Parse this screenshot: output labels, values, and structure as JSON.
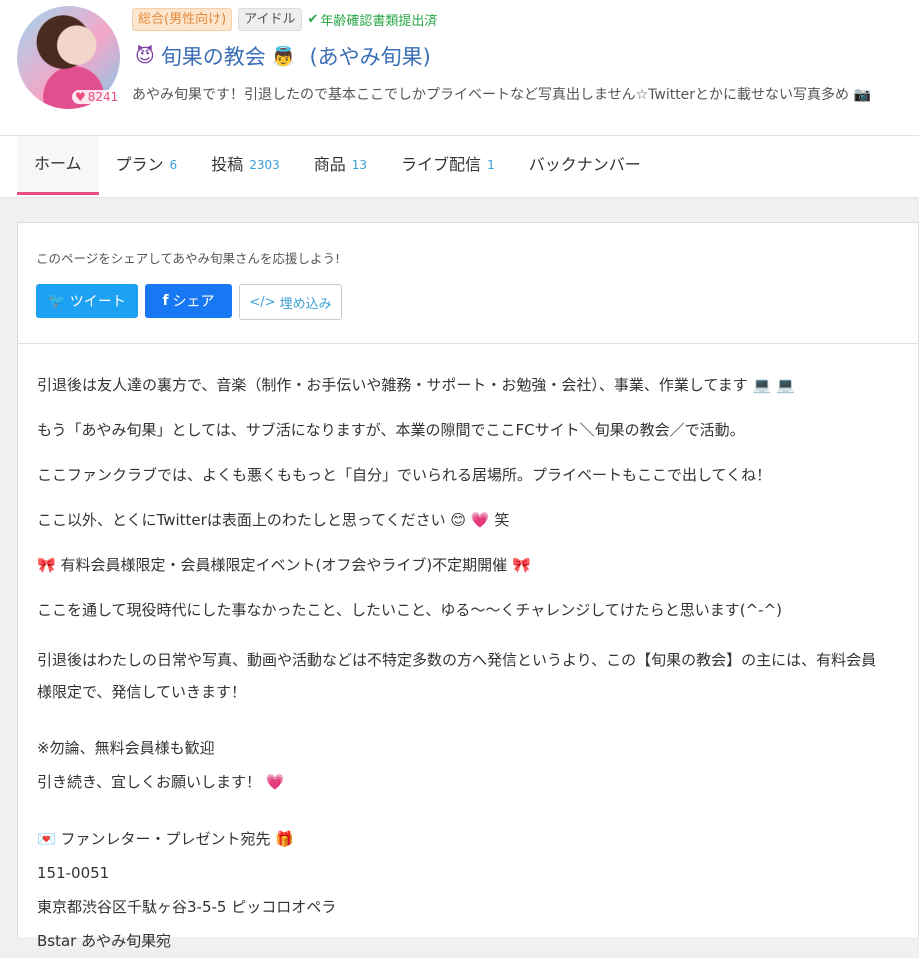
{
  "profile": {
    "likes": "8241",
    "tags": [
      "総合(男性向け)",
      "アイドル"
    ],
    "verified_label": "年齢確認書類提出済",
    "title": "旬果の教会",
    "owner": "(あやみ旬果)",
    "description": "あやみ旬果です！引退したので基本ここでしかプライベートなど写真出しません☆Twitterとかに載せない写真多め"
  },
  "nav": {
    "tabs": [
      {
        "label": "ホーム",
        "count": ""
      },
      {
        "label": "プラン",
        "count": "6"
      },
      {
        "label": "投稿",
        "count": "2303"
      },
      {
        "label": "商品",
        "count": "13"
      },
      {
        "label": "ライブ配信",
        "count": "1"
      },
      {
        "label": "バックナンバー",
        "count": ""
      }
    ]
  },
  "share": {
    "prompt": "このページをシェアしてあやみ旬果さんを応援しよう!",
    "tweet": "ツイート",
    "facebook": "シェア",
    "embed": "埋め込み"
  },
  "content": {
    "p1": "引退後は友人達の裏方で、音楽（制作・お手伝いや雑務・サポート・お勉強・会社）、事業、作業してます",
    "p2": "もう「あやみ旬果」としては、サブ活になりますが、本業の隙間でここFCサイト＼旬果の教会／で活動。",
    "p3": "ここファンクラブでは、よくも悪くももっと「自分」でいられる居場所。プライベートもここで出してくね！",
    "p4": "ここ以外、とくにTwitterは表面上のわたしと思ってください",
    "p4_end": "笑",
    "p5": "有料会員様限定・会員様限定イベント(オフ会やライブ)不定期開催",
    "p6": "ここを通して現役時代にした事なかったこと、したいこと、ゆる〜〜くチャレンジしてけたらと思います(^-^)",
    "p7": "引退後はわたしの日常や写真、動画や活動などは不特定多数の方へ発信というより、この【旬果の教会】の主には、有料会員様限定で、発信していきます！",
    "p8a": "※勿論、無料会員様も歓迎",
    "p8b": "引き続き、宜しくお願いします！",
    "p9a": "ファンレター・プレゼント宛先",
    "p9b": "151-0051",
    "p9c": "東京都渋谷区千駄ヶ谷3-5-5 ピッコロオペラ",
    "p9d": "Bstar あやみ旬果宛"
  }
}
